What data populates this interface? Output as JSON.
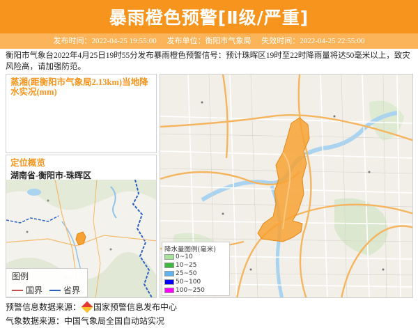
{
  "header": {
    "title": "暴雨橙色预警[Ⅱ级/严重]",
    "publish_time": "发布时间：2022-04-25 19:55:00",
    "publisher": "发布单位：衡阳市气象局",
    "expire_time": "失效时间：2022-04-25 22:55:00"
  },
  "description": "衡阳市气象台2022年4月25日19时55分发布暴雨橙色预警信号：预计珠晖区19时至22时降雨量将达50毫米以上，致灾风险高，请加强防范。",
  "rain_panel": {
    "title": "蒸湘(距衡阳市气象局2.13km)当地降水实况(mm)"
  },
  "location_panel": {
    "title": "定位概览",
    "region": "湖南省-衡阳市-珠晖区"
  },
  "country_legend": {
    "title": "图例",
    "national_border": "国界",
    "provincial_border": "省界",
    "national_color": "#c0504d",
    "provincial_color": "#2a5fc4"
  },
  "rain_legend": {
    "title": "降水量图例(毫米)",
    "items": [
      {
        "label": "0~10",
        "color": "#a6e39a"
      },
      {
        "label": "10~25",
        "color": "#3dba3d"
      },
      {
        "label": "25~50",
        "color": "#5fb3f0"
      },
      {
        "label": "50~100",
        "color": "#0000ff"
      },
      {
        "label": "100~250",
        "color": "#ff00ff"
      }
    ]
  },
  "sources": {
    "warning_source_label": "预警信息数据来源：",
    "warning_source_name": "国家预警信息发布中心",
    "weather_source_label": "气象数据来源：",
    "weather_source_name": "中国气象局全国自动站实况"
  },
  "colors": {
    "accent": "#f7941d",
    "warning_area": "#f7a234"
  }
}
